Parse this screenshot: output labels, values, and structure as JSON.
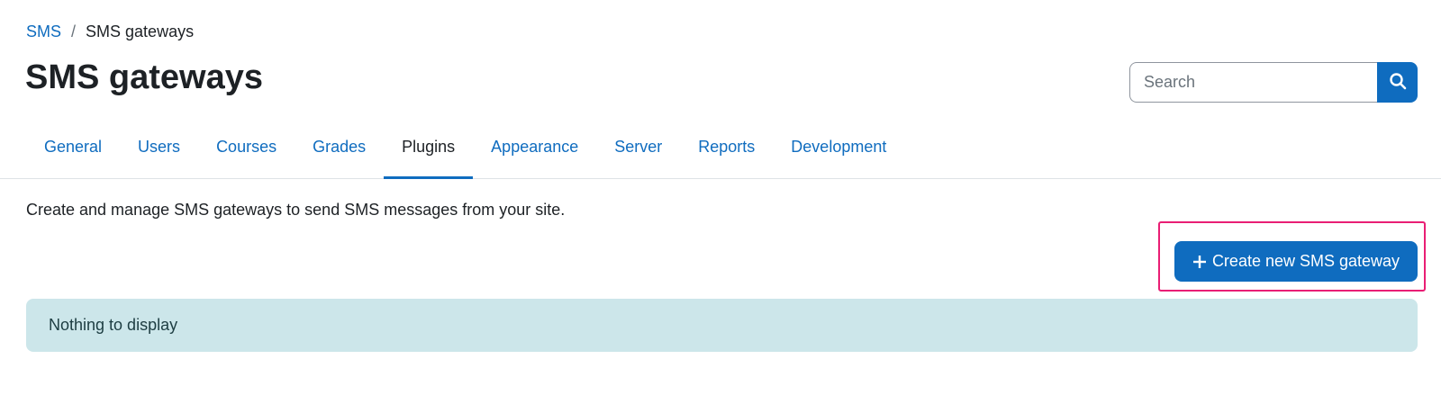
{
  "breadcrumb": {
    "items": [
      {
        "label": "SMS"
      },
      {
        "label": "SMS gateways"
      }
    ],
    "separator": "/"
  },
  "page_title": "SMS gateways",
  "search": {
    "placeholder": "Search",
    "value": "",
    "button_icon": "search-icon"
  },
  "tabs": {
    "items": [
      {
        "label": "General"
      },
      {
        "label": "Users"
      },
      {
        "label": "Courses"
      },
      {
        "label": "Grades"
      },
      {
        "label": "Plugins",
        "active": true
      },
      {
        "label": "Appearance"
      },
      {
        "label": "Server"
      },
      {
        "label": "Reports"
      },
      {
        "label": "Development"
      }
    ]
  },
  "description": "Create and manage SMS gateways to send SMS messages from your site.",
  "create_button": {
    "label": "Create new SMS gateway",
    "icon": "plus-icon"
  },
  "notice": {
    "text": "Nothing to display"
  },
  "colors": {
    "accent": "#0f6cbf",
    "highlight": "#e91e74",
    "notice_bg": "#cce6ea"
  }
}
